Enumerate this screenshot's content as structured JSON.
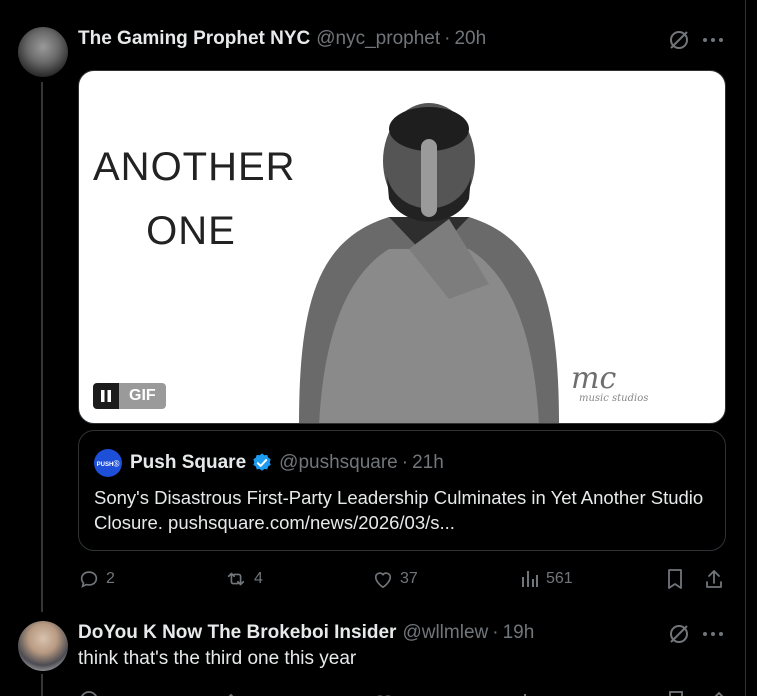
{
  "post1": {
    "name": "The Gaming Prophet NYC",
    "handle": "@nyc_prophet",
    "separator": "·",
    "time": "20h",
    "media": {
      "text_line1": "ANOTHER",
      "text_line2": "ONE",
      "signature": "mc",
      "signature_sub": "music studios",
      "gif_label": "GIF"
    },
    "quote": {
      "avatar_text": "PUSHⓈ",
      "name": "Push Square",
      "handle": "@pushsquare",
      "separator": "·",
      "time": "21h",
      "text": "Sony's Disastrous First-Party Leadership Culminates in Yet Another Studio Closure. pushsquare.com/news/2026/03/s..."
    },
    "actions": {
      "replies": "2",
      "reposts": "4",
      "likes": "37",
      "views": "561"
    }
  },
  "post2": {
    "name": "DoYou K Now The Brokeboi Insider",
    "handle": "@wllmlew",
    "separator": "·",
    "time": "19h",
    "text": "think that's the third one this year"
  },
  "icons": [
    "grok-icon",
    "more-icon",
    "reply-icon",
    "repost-icon",
    "like-icon",
    "views-icon",
    "bookmark-icon",
    "share-icon",
    "verified-icon",
    "pause-icon"
  ],
  "colors": {
    "background": "#000000",
    "text": "#e7e9ea",
    "muted": "#71767b",
    "border": "#2f3336",
    "verified": "#1d9bf0"
  }
}
